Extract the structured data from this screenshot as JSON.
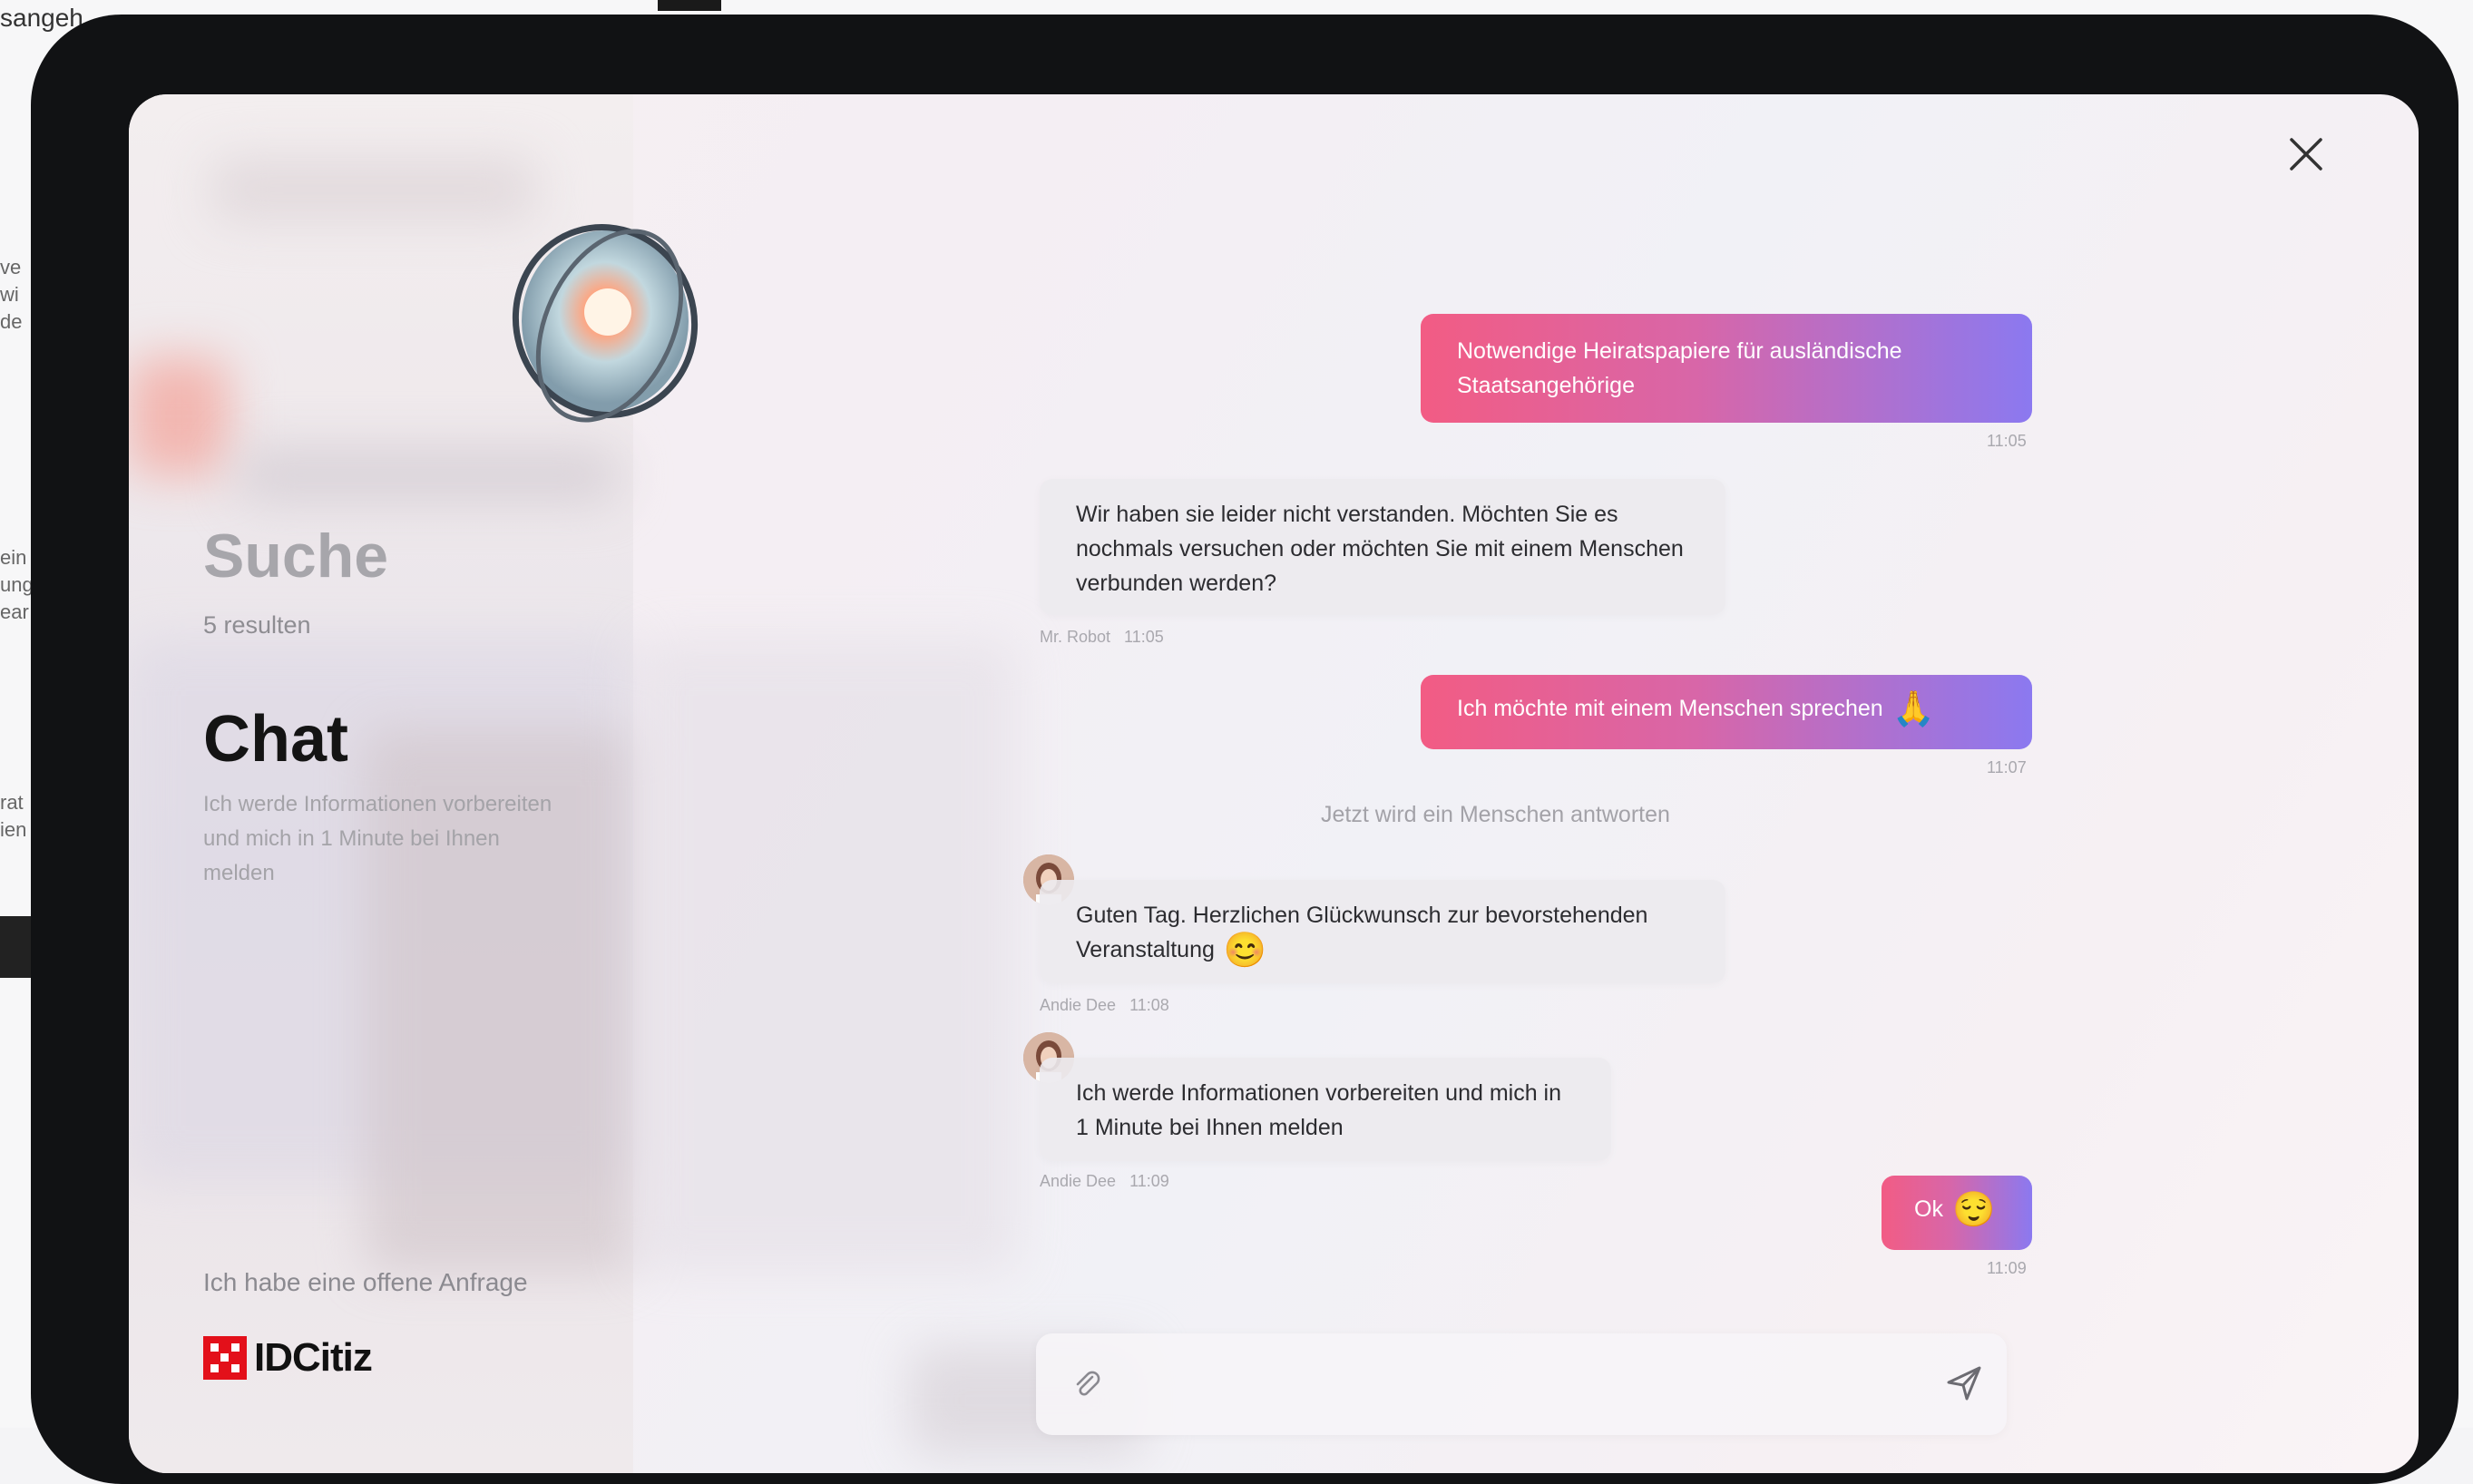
{
  "background": {
    "top_text": "sangeh",
    "edge_fragments": [
      "ve",
      "wi",
      "de",
      "ein",
      "ung",
      "ear",
      "rat",
      "ien"
    ]
  },
  "sidebar": {
    "search_title": "Suche",
    "results_count": "5 resulten",
    "chat_title": "Chat",
    "chat_description": "Ich werde Informationen vorbereiten und mich in 1 Minute bei Ihnen melden",
    "open_request_link": "Ich habe eine offene Anfrage",
    "brand_name": "IDCitiz"
  },
  "chat": {
    "messages": [
      {
        "type": "outgoing",
        "text": "Notwendige Heiratspapiere für ausländische Staatsangehörige",
        "time": "11:05"
      },
      {
        "type": "incoming",
        "text": "Wir haben sie leider nicht verstanden. Möchten Sie es nochmals versuchen oder möchten Sie mit einem Menschen verbunden werden?",
        "author": "Mr. Robot",
        "time": "11:05"
      },
      {
        "type": "outgoing",
        "text": "Ich möchte mit einem Menschen sprechen",
        "emoji": "🙏",
        "time": "11:07"
      },
      {
        "type": "system",
        "text": "Jetzt wird ein Menschen antworten"
      },
      {
        "type": "incoming",
        "text": "Guten Tag. Herzlichen Glückwunsch zur bevorstehenden Veranstaltung",
        "emoji": "😊",
        "author": "Andie Dee",
        "time": "11:08"
      },
      {
        "type": "incoming",
        "text": "Ich werde Informationen vorbereiten und mich in 1 Minute bei Ihnen melden",
        "author": "Andie Dee",
        "time": "11:09"
      },
      {
        "type": "outgoing",
        "text": "Ok",
        "emoji": "😌",
        "time": "11:09"
      }
    ]
  },
  "composer": {
    "placeholder": ""
  },
  "icons": {
    "close": "close-icon",
    "attach": "paperclip-icon",
    "send": "send-icon"
  },
  "colors": {
    "bubble_gradient_start": "#f25c84",
    "bubble_gradient_end": "#8b79f0",
    "brand_red": "#e3101a"
  }
}
